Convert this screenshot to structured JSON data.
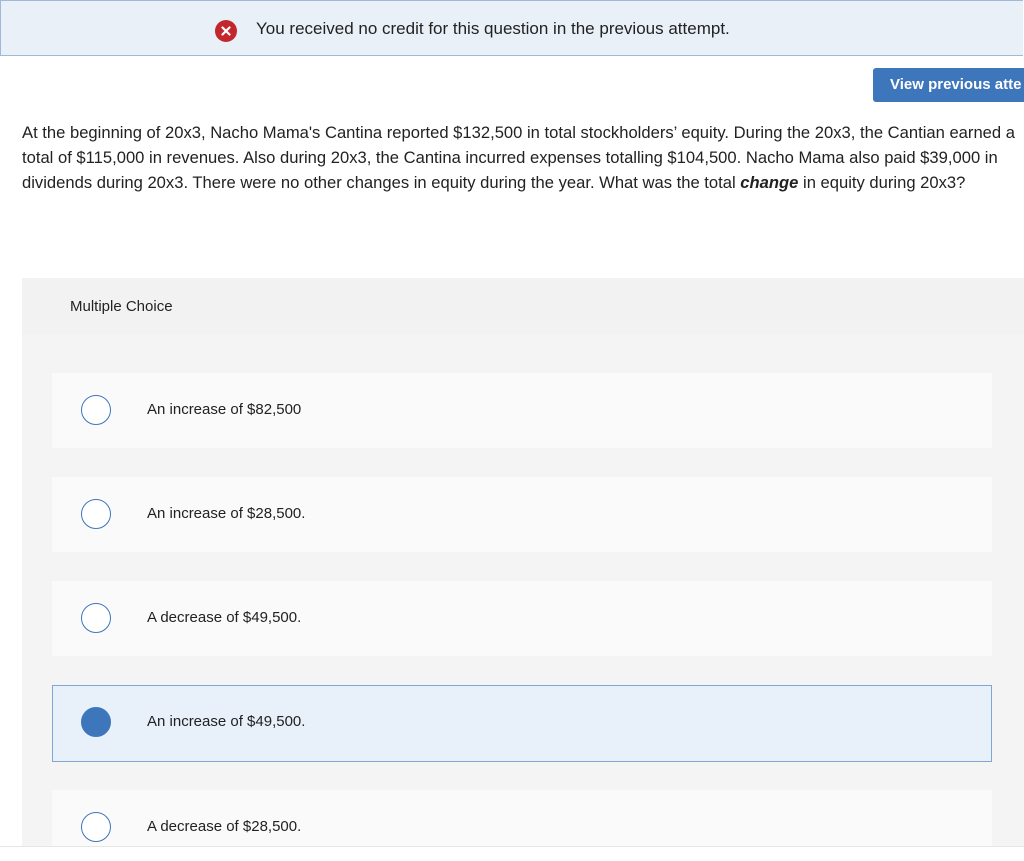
{
  "banner": {
    "message": "You received no credit for this question in the previous attempt.",
    "icon": "close-icon",
    "icon_color": "#c1272d"
  },
  "view_previous": {
    "label": "View previous atte"
  },
  "question": {
    "text_before": "At the beginning of 20x3, Nacho Mama's Cantina reported $132,500 in total stockholders’ equity. During the 20x3, the Cantian earned a total of  $115,000 in revenues. Also during 20x3, the Cantina incurred expenses totalling $104,500. Nacho Mama also paid $39,000 in dividends during 20x3. There were no other changes in equity during the year. What was the total ",
    "emphasis": "change",
    "text_after": " in equity during 20x3?"
  },
  "multiple_choice": {
    "header": "Multiple Choice",
    "options": [
      {
        "label": "An increase of $82,500",
        "selected": false
      },
      {
        "label": "An increase of $28,500.",
        "selected": false
      },
      {
        "label": "A decrease of $49,500.",
        "selected": false
      },
      {
        "label": "An increase of $49,500.",
        "selected": true
      },
      {
        "label": "A decrease of $28,500.",
        "selected": false
      }
    ]
  },
  "colors": {
    "accent": "#3e76bb",
    "banner_bg": "#e9f0f8",
    "error": "#c1272d"
  }
}
